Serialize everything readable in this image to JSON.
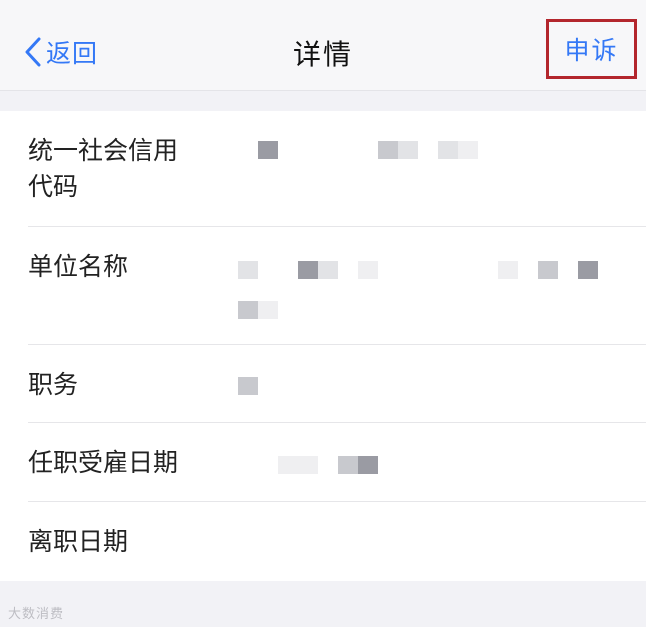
{
  "nav": {
    "back_label": "返回",
    "title": "详情",
    "appeal_label": "申诉"
  },
  "fields": [
    {
      "label_line1": "统一社会信用",
      "label_line2": "代码",
      "value": "redacted"
    },
    {
      "label": "单位名称",
      "value": "redacted"
    },
    {
      "label": "职务",
      "value": "redacted"
    },
    {
      "label": "任职受雇日期",
      "value": "redacted"
    },
    {
      "label": "离职日期",
      "value": ""
    }
  ],
  "watermark": "大数消费",
  "colors": {
    "accent": "#3478f6",
    "highlight_border": "#b3262d",
    "group_background": "#f2f2f6"
  },
  "icons": {
    "back": "chevron-left-icon"
  }
}
